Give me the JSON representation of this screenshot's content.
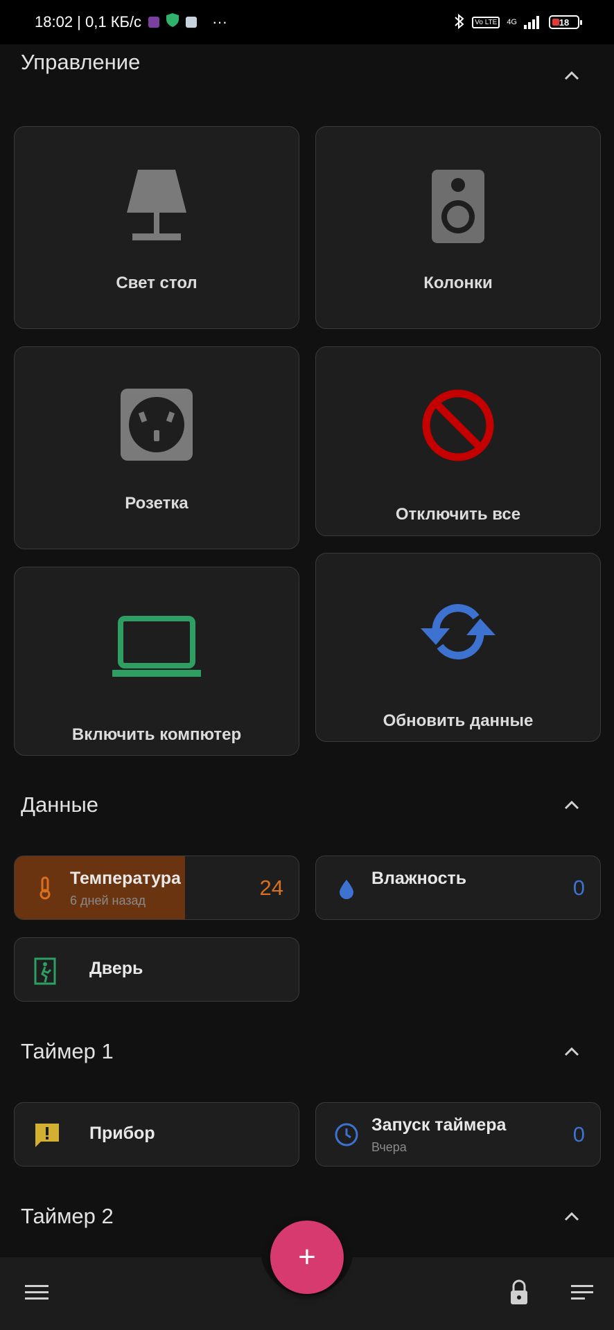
{
  "status_bar": {
    "time_speed": "18:02 | 0,1 КБ/с",
    "more": "···",
    "network": "4G",
    "battery": "18"
  },
  "sections": {
    "control": {
      "title": "Управление"
    },
    "data": {
      "title": "Данные"
    },
    "timer1": {
      "title": "Таймер 1"
    },
    "timer2": {
      "title": "Таймер 2"
    }
  },
  "tiles": [
    {
      "label": "Свет стол",
      "icon": "lamp-icon",
      "color": "#7a7a7a"
    },
    {
      "label": "Колонки",
      "icon": "speaker-icon",
      "color": "#6e6e6e"
    },
    {
      "label": "Розетка",
      "icon": "power-outlet-icon",
      "color": "#7a7a7a"
    },
    {
      "label": "Отключить все",
      "icon": "block-icon",
      "color": "#c40000"
    },
    {
      "label": "Включить компютер",
      "icon": "laptop-icon",
      "color": "#2e9e62"
    },
    {
      "label": "Обновить данные",
      "icon": "sync-icon",
      "color": "#3d72d0"
    }
  ],
  "data_cards": {
    "temperature": {
      "title": "Температура",
      "subtitle": "6 дней назад",
      "value": "24",
      "icon": "thermometer-icon",
      "color": "#d9701e",
      "highlight": "#6b3410"
    },
    "humidity": {
      "title": "Влажность",
      "value": "0",
      "icon": "water-drop-icon",
      "color": "#3d72d0"
    },
    "door": {
      "title": "Дверь",
      "icon": "door-exit-icon",
      "color": "#2e9e62"
    }
  },
  "timer_cards": {
    "device": {
      "title": "Прибор",
      "icon": "alert-message-icon",
      "color": "#d4b030"
    },
    "timer_start": {
      "title": "Запуск таймера",
      "subtitle": "Вчера",
      "value": "0",
      "icon": "clock-icon",
      "color": "#3d72d0"
    }
  },
  "bottom_bar": {
    "fab": "+",
    "fab_color": "#d63a6e"
  }
}
